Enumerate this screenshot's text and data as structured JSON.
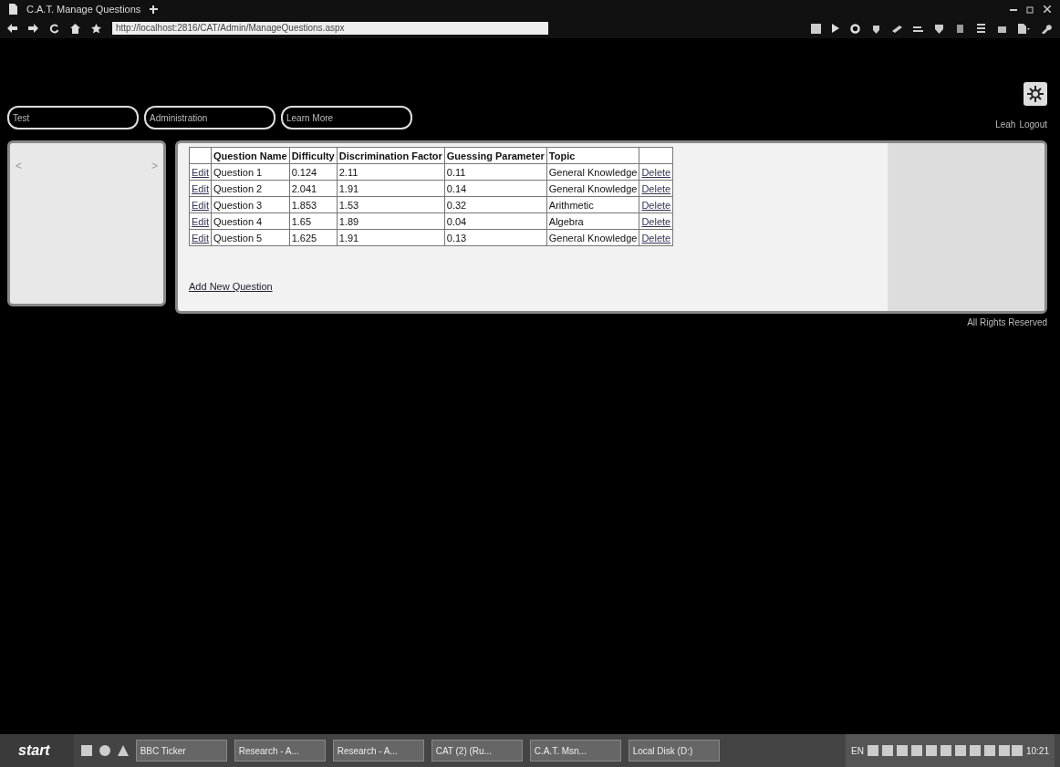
{
  "browser": {
    "tab_title": "C.A.T. Manage Questions",
    "address": "http://localhost:2816/CAT/Admin/ManageQuestions.aspx"
  },
  "nav": [
    {
      "label": "Test"
    },
    {
      "label": "Administration"
    },
    {
      "label": "Learn More"
    }
  ],
  "user": {
    "name": "Leah",
    "logout": "Logout"
  },
  "side_panel": {
    "prev": "<",
    "next": ">"
  },
  "table": {
    "columns": [
      "",
      "Question Name",
      "Difficulty",
      "Discrimination Factor",
      "Guessing Parameter",
      "Topic",
      ""
    ],
    "rows": [
      {
        "edit": "Edit",
        "name": "Question 1",
        "difficulty": "0.124",
        "discrimination": "2.11",
        "guessing": "0.11",
        "topic": "General Knowledge",
        "delete": "Delete"
      },
      {
        "edit": "Edit",
        "name": "Question 2",
        "difficulty": "2.041",
        "discrimination": "1.91",
        "guessing": "0.14",
        "topic": "General Knowledge",
        "delete": "Delete"
      },
      {
        "edit": "Edit",
        "name": "Question 3",
        "difficulty": "1.853",
        "discrimination": "1.53",
        "guessing": "0.32",
        "topic": "Arithmetic",
        "delete": "Delete"
      },
      {
        "edit": "Edit",
        "name": "Question 4",
        "difficulty": "1.65",
        "discrimination": "1.89",
        "guessing": "0.04",
        "topic": "Algebra",
        "delete": "Delete"
      },
      {
        "edit": "Edit",
        "name": "Question 5",
        "difficulty": "1.625",
        "discrimination": "1.91",
        "guessing": "0.13",
        "topic": "General Knowledge",
        "delete": "Delete"
      }
    ]
  },
  "add_link": "Add New Question",
  "footer": "All Rights Reserved",
  "taskbar": {
    "start": "start",
    "tasks": [
      "BBC Ticker",
      "Research - A...",
      "Research - A...",
      "CAT (2) (Ru...",
      "C.A.T. Msn...",
      "Local Disk (D:)"
    ],
    "language": "EN",
    "time": "10:21"
  }
}
